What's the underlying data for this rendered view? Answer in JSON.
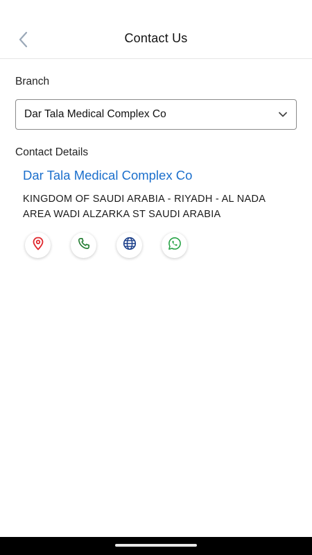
{
  "header": {
    "title": "Contact Us",
    "back_icon": "chevron-left-icon"
  },
  "branch": {
    "label": "Branch",
    "selected": "Dar Tala Medical Complex Co",
    "dropdown_icon": "chevron-down-icon"
  },
  "contact": {
    "label": "Contact Details",
    "name": "Dar Tala Medical Complex Co",
    "address": "KINGDOM OF SAUDI ARABIA - RIYADH - AL NADA AREA WADI ALZARKA ST SAUDI ARABIA"
  },
  "actions": [
    {
      "icon": "location-pin-icon",
      "color": "#e0262b"
    },
    {
      "icon": "phone-icon",
      "color": "#1e7a2e"
    },
    {
      "icon": "globe-icon",
      "color": "#1b3f8a"
    },
    {
      "icon": "whatsapp-icon",
      "color": "#25a244"
    }
  ],
  "colors": {
    "accent": "#1b6fcc",
    "border": "#8a8a8a"
  }
}
